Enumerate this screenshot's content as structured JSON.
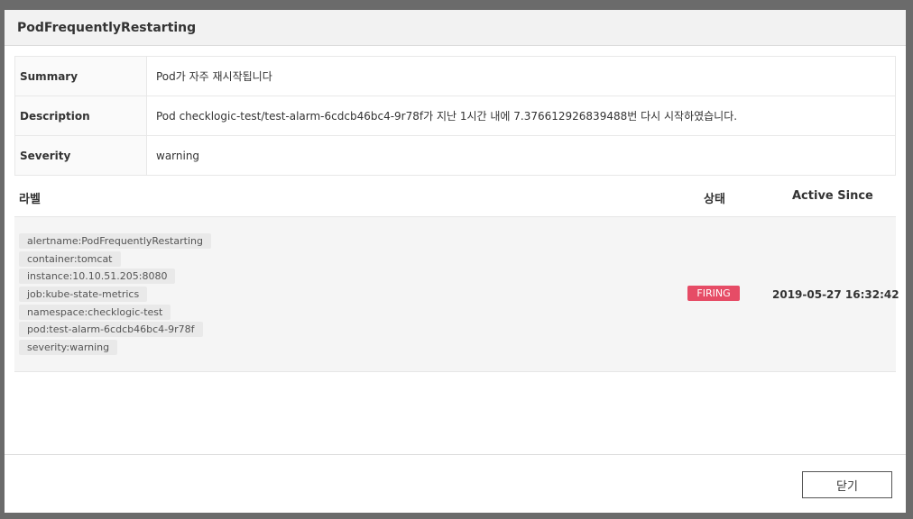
{
  "modal": {
    "title": "PodFrequentlyRestarting"
  },
  "info": {
    "rows": [
      {
        "key": "Summary",
        "value": "Pod가 자주 재시작됩니다"
      },
      {
        "key": "Description",
        "value": "Pod checklogic-test/test-alarm-6cdcb46bc4-9r78f가 지난 1시간 내에 7.376612926839488번 다시 시작하였습니다."
      },
      {
        "key": "Severity",
        "value": "warning"
      }
    ]
  },
  "alerts": {
    "headers": {
      "labels": "라벨",
      "state": "상태",
      "active_since": "Active Since"
    },
    "rows": [
      {
        "labels": [
          "alertname:PodFrequentlyRestarting",
          "container:tomcat",
          "instance:10.10.51.205:8080",
          "job:kube-state-metrics",
          "namespace:checklogic-test",
          "pod:test-alarm-6cdcb46bc4-9r78f",
          "severity:warning"
        ],
        "state": "FIRING",
        "active_since": "2019-05-27 16:32:42"
      }
    ]
  },
  "footer": {
    "close_label": "닫기"
  },
  "colors": {
    "firing": "#e64c66",
    "overlay": "#6b6b6b"
  }
}
